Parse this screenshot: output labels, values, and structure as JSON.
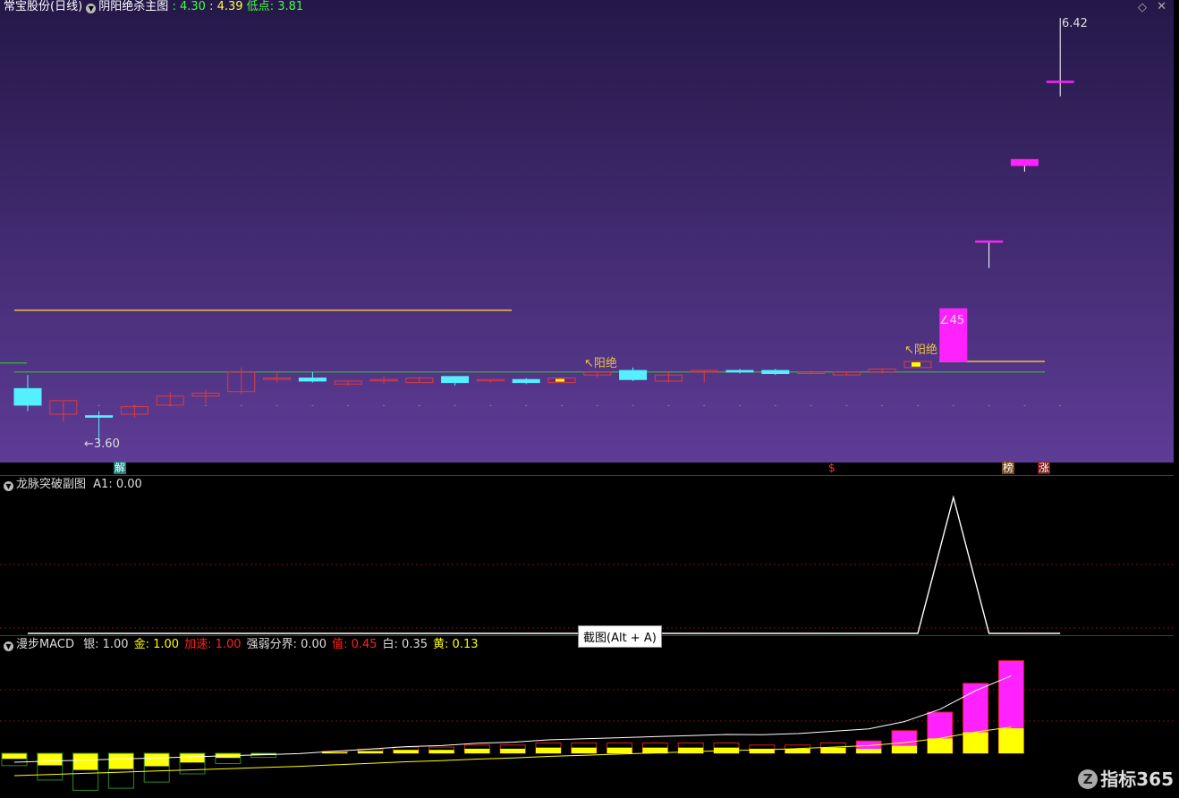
{
  "main": {
    "stock_label": "常宝股份(日线)",
    "indicator_name": "阴阳绝杀主图",
    "v1": ": 4.30",
    "v2": ": 4.39",
    "low_label": "低点",
    "low_value": ": 3.81",
    "colors": {
      "bg_top": "#241848",
      "bg_bottom": "#5e3c96",
      "up": "#e03a3a",
      "down": "#55f0ff",
      "magenta": "#ff22ff",
      "gold": "#e8c040",
      "green": "#30c030"
    },
    "annotations": {
      "high": "6.42",
      "low": "←3.60",
      "level": "45",
      "yangjue_1": "↖阳绝",
      "yangjue_2": "↖阳绝"
    },
    "badges": {
      "jie": "解",
      "s": "$",
      "bang": "榜",
      "zhang": "涨"
    },
    "candles": [
      {
        "o": 3.96,
        "h": 4.05,
        "l": 3.81,
        "c": 3.85
      },
      {
        "o": 3.79,
        "h": 3.88,
        "l": 3.74,
        "c": 3.88
      },
      {
        "o": 3.78,
        "h": 3.81,
        "l": 3.6,
        "c": 3.77
      },
      {
        "o": 3.79,
        "h": 3.85,
        "l": 3.77,
        "c": 3.84
      },
      {
        "o": 3.85,
        "h": 3.94,
        "l": 3.85,
        "c": 3.91
      },
      {
        "o": 3.91,
        "h": 3.95,
        "l": 3.86,
        "c": 3.93
      },
      {
        "o": 3.94,
        "h": 4.1,
        "l": 3.92,
        "c": 4.07
      },
      {
        "o": 4.03,
        "h": 4.07,
        "l": 4.0,
        "c": 4.03
      },
      {
        "o": 4.03,
        "h": 4.07,
        "l": 4.0,
        "c": 4.01
      },
      {
        "o": 3.99,
        "h": 4.01,
        "l": 3.98,
        "c": 4.01
      },
      {
        "o": 4.02,
        "h": 4.04,
        "l": 3.99,
        "c": 4.02
      },
      {
        "o": 4.0,
        "h": 4.04,
        "l": 4.0,
        "c": 4.03
      },
      {
        "o": 4.04,
        "h": 4.04,
        "l": 3.98,
        "c": 4.0
      },
      {
        "o": 4.02,
        "h": 4.02,
        "l": 4.0,
        "c": 4.02
      },
      {
        "o": 4.02,
        "h": 4.03,
        "l": 3.99,
        "c": 4.0
      },
      {
        "o": 4.0,
        "h": 4.03,
        "l": 4.0,
        "c": 4.03
      },
      {
        "o": 4.05,
        "h": 4.07,
        "l": 4.03,
        "c": 4.07
      },
      {
        "o": 4.08,
        "h": 4.1,
        "l": 4.01,
        "c": 4.02
      },
      {
        "o": 4.01,
        "h": 4.07,
        "l": 4.0,
        "c": 4.05
      },
      {
        "o": 4.07,
        "h": 4.08,
        "l": 4.0,
        "c": 4.08
      },
      {
        "o": 4.08,
        "h": 4.09,
        "l": 4.06,
        "c": 4.07
      },
      {
        "o": 4.08,
        "h": 4.09,
        "l": 4.05,
        "c": 4.06
      },
      {
        "o": 4.06,
        "h": 4.08,
        "l": 4.06,
        "c": 4.07
      },
      {
        "o": 4.05,
        "h": 4.07,
        "l": 4.05,
        "c": 4.07
      },
      {
        "o": 4.07,
        "h": 4.09,
        "l": 4.06,
        "c": 4.09
      },
      {
        "o": 4.1,
        "h": 4.14,
        "l": 4.1,
        "c": 4.14
      },
      {
        "o": 4.14,
        "h": 4.49,
        "l": 4.14,
        "c": 4.49
      },
      {
        "o": 4.94,
        "h": 4.94,
        "l": 4.76,
        "c": 4.94
      },
      {
        "o": 5.44,
        "h": 5.44,
        "l": 5.4,
        "c": 5.48
      },
      {
        "o": 6.0,
        "h": 6.42,
        "l": 5.9,
        "c": 6.0
      }
    ],
    "green_level": 4.07,
    "gold_level": 4.48
  },
  "sub1": {
    "indicator_name": "龙脉突破副图",
    "a1_label": "A1",
    "a1_value": ": 0.00",
    "series": [
      0,
      0,
      0,
      0,
      0,
      0,
      0,
      0,
      0,
      0,
      0,
      0,
      0,
      0,
      0,
      0,
      0,
      0,
      0,
      0,
      0,
      0,
      0,
      0,
      0,
      0,
      1,
      0,
      0,
      0
    ]
  },
  "sub2": {
    "indicator_name": "漫步MACD",
    "items": [
      {
        "label": "银",
        "value": ": 1.00",
        "color": "#ddd"
      },
      {
        "label": "金",
        "value": ": 1.00",
        "color": "#ffff00"
      },
      {
        "label": "加速",
        "value": ": 1.00",
        "color": "#ff2020"
      },
      {
        "label": "强弱分界",
        "value": ": 0.00",
        "color": "#ddd"
      },
      {
        "label": "值",
        "value": ": 0.45",
        "color": "#ff2020"
      },
      {
        "label": "白",
        "value": ": 0.35",
        "color": "#ddd"
      },
      {
        "label": "黄",
        "value": ": 0.13",
        "color": "#ffff00"
      }
    ],
    "bars": [
      -0.06,
      -0.13,
      -0.18,
      -0.17,
      -0.14,
      -0.1,
      -0.05,
      -0.02,
      0.0,
      0.01,
      0.02,
      0.03,
      0.03,
      0.04,
      0.04,
      0.05,
      0.05,
      0.05,
      0.05,
      0.05,
      0.05,
      0.04,
      0.04,
      0.05,
      0.06,
      0.11,
      0.2,
      0.34,
      0.45
    ],
    "yellow_frac": [
      1,
      1,
      1,
      1,
      1,
      1,
      1,
      1,
      1,
      1,
      1,
      1,
      1,
      1,
      1,
      1,
      1,
      1,
      1,
      1,
      1,
      1,
      1,
      1,
      0.6,
      0.55,
      0.6,
      0.5,
      0.45
    ]
  },
  "tooltip": "截图(Alt + A)",
  "watermark": "指标365"
}
